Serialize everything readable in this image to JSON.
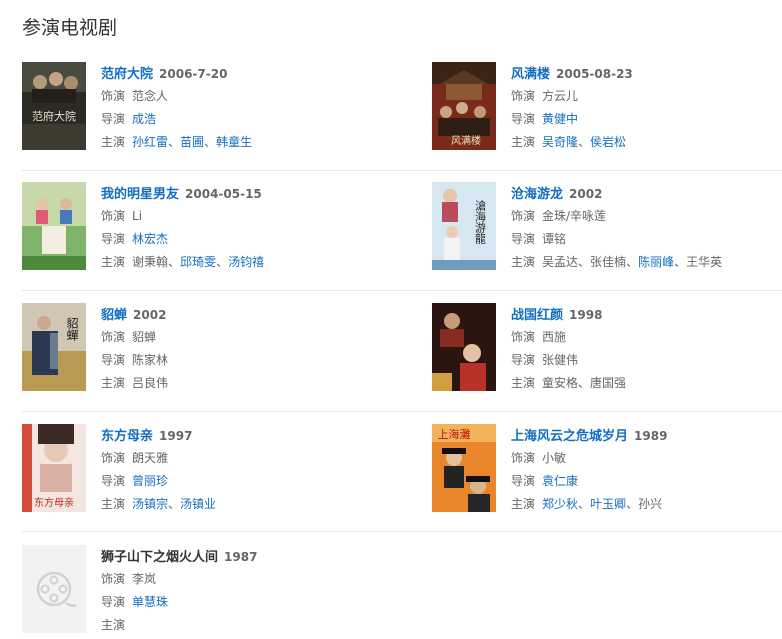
{
  "section": {
    "title": "参演电视剧"
  },
  "works": [
    {
      "title": "范府大院",
      "date": "2006-7-20",
      "role_label": "饰演",
      "role": "范念人",
      "director_label": "导演",
      "director": [
        {
          "name": "成浩",
          "link": true
        }
      ],
      "cast_label": "主演",
      "cast": [
        {
          "name": "孙红雷",
          "link": true
        },
        {
          "name": "苗圃",
          "link": true
        },
        {
          "name": "韩童生",
          "link": true
        }
      ],
      "poster_text": "范府大院",
      "poster_icon": "poster-fanfudayuan"
    },
    {
      "title": "风满楼",
      "date": "2005-08-23",
      "role_label": "饰演",
      "role": "方云儿",
      "director_label": "导演",
      "director": [
        {
          "name": "黄健中",
          "link": true
        }
      ],
      "cast_label": "主演",
      "cast": [
        {
          "name": "吴奇隆",
          "link": true
        },
        {
          "name": "侯岩松",
          "link": true
        }
      ],
      "poster_text": "风满楼",
      "poster_icon": "poster-fengmanlou"
    },
    {
      "title": "我的明星男友",
      "date": "2004-05-15",
      "role_label": "饰演",
      "role": "Li",
      "director_label": "导演",
      "director": [
        {
          "name": "林宏杰",
          "link": true
        }
      ],
      "cast_label": "主演",
      "cast": [
        {
          "name": "谢秉翰",
          "link": false
        },
        {
          "name": "邱琦雯",
          "link": true
        },
        {
          "name": "汤钧禧",
          "link": true
        }
      ],
      "poster_text": "",
      "poster_icon": "poster-mingxingnanyou"
    },
    {
      "title": "沧海游龙",
      "date": "2002",
      "role_label": "饰演",
      "role": "金珠/辛咏莲",
      "director_label": "导演",
      "director": [
        {
          "name": "谭铭",
          "link": false
        }
      ],
      "cast_label": "主演",
      "cast": [
        {
          "name": "吴孟达",
          "link": false
        },
        {
          "name": "张佳楠",
          "link": false
        },
        {
          "name": "陈丽峰",
          "link": true
        },
        {
          "name": "王华英",
          "link": false
        }
      ],
      "poster_text": "滄海游龍",
      "poster_icon": "poster-canghaiyoulong"
    },
    {
      "title": "貂蝉",
      "date": "2002",
      "role_label": "饰演",
      "role": "貂蝉",
      "director_label": "导演",
      "director": [
        {
          "name": "陈家林",
          "link": false
        }
      ],
      "cast_label": "主演",
      "cast": [
        {
          "name": "吕良伟",
          "link": false
        }
      ],
      "poster_text": "貂蟬",
      "poster_icon": "poster-diaochan"
    },
    {
      "title": "战国红颜",
      "date": "1998",
      "role_label": "饰演",
      "role": "西施",
      "director_label": "导演",
      "director": [
        {
          "name": "张健伟",
          "link": false
        }
      ],
      "cast_label": "主演",
      "cast": [
        {
          "name": "童安格",
          "link": false
        },
        {
          "name": "唐国强",
          "link": false
        }
      ],
      "poster_text": "",
      "poster_icon": "poster-zhanguohongyan"
    },
    {
      "title": "东方母亲",
      "date": "1997",
      "role_label": "饰演",
      "role": "朗天雅",
      "director_label": "导演",
      "director": [
        {
          "name": "曾丽珍",
          "link": true
        }
      ],
      "cast_label": "主演",
      "cast": [
        {
          "name": "汤镇宗",
          "link": true
        },
        {
          "name": "汤镇业",
          "link": true
        }
      ],
      "poster_text": "东方母亲",
      "poster_icon": "poster-dongfangmuqin"
    },
    {
      "title": "上海风云之危城岁月",
      "date": "1989",
      "role_label": "饰演",
      "role": "小敏",
      "director_label": "导演",
      "director": [
        {
          "name": "袁仁康",
          "link": true
        }
      ],
      "cast_label": "主演",
      "cast": [
        {
          "name": "郑少秋",
          "link": true
        },
        {
          "name": "叶玉卿",
          "link": true
        },
        {
          "name": "孙兴",
          "link": false
        }
      ],
      "poster_text": "上海灘",
      "poster_icon": "poster-shanghaifengyun"
    },
    {
      "title": "狮子山下之烟火人间",
      "date": "1987",
      "role_label": "饰演",
      "role": "李岚",
      "director_label": "导演",
      "director": [
        {
          "name": "单慧珠",
          "link": true
        }
      ],
      "cast_label": "主演",
      "cast": [],
      "poster_text": "",
      "poster_icon": "film-reel-placeholder-icon",
      "title_plain": true
    }
  ],
  "colors": {
    "link": "#136ec2",
    "text": "#333333",
    "muted": "#666666",
    "divider": "#e6e6e6"
  }
}
